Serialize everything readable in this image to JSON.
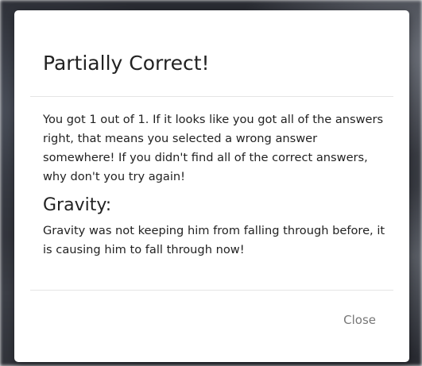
{
  "modal": {
    "title": "Partially Correct!",
    "message": "You got 1 out of 1. If it looks like you got all of the answers right, that means you selected a wrong answer somewhere! If you didn't find all of the correct answers, why don't you try again!",
    "answers": [
      {
        "title": "Gravity:",
        "explanation": "Gravity was not keeping him from falling through before, it is causing him to fall through now!"
      }
    ],
    "close_label": "Close"
  }
}
